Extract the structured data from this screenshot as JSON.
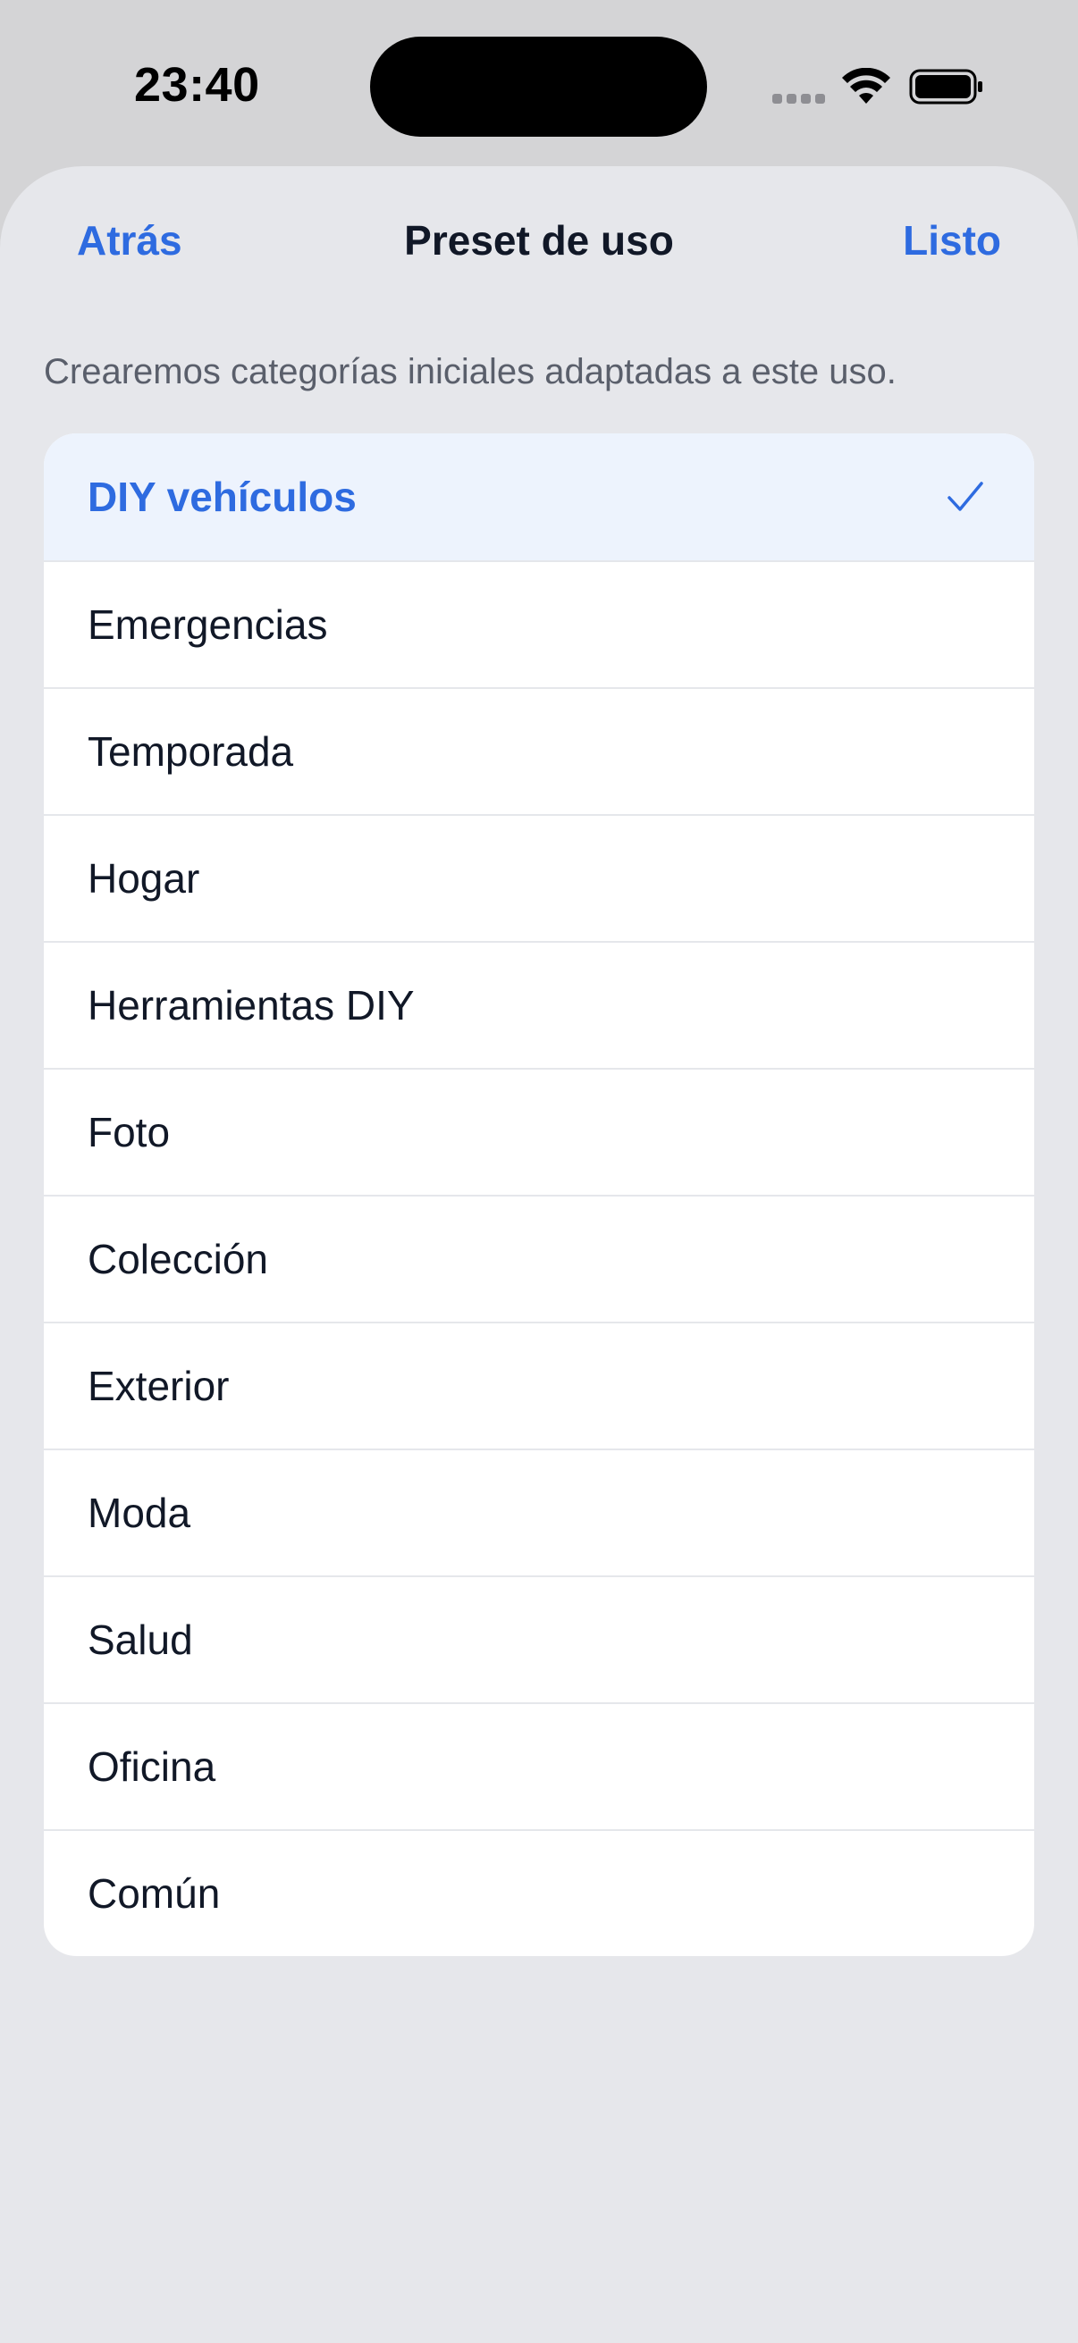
{
  "status_bar": {
    "time": "23:40",
    "icons": [
      "cellular-signal-icon",
      "wifi-icon",
      "battery-icon"
    ]
  },
  "nav": {
    "back_label": "Atrás",
    "title": "Preset de uso",
    "done_label": "Listo"
  },
  "description": "Crearemos categorías iniciales adaptadas a este uso.",
  "presets": [
    {
      "label": "DIY vehículos",
      "selected": true
    },
    {
      "label": "Emergencias",
      "selected": false
    },
    {
      "label": "Temporada",
      "selected": false
    },
    {
      "label": "Hogar",
      "selected": false
    },
    {
      "label": "Herramientas DIY",
      "selected": false
    },
    {
      "label": "Foto",
      "selected": false
    },
    {
      "label": "Colección",
      "selected": false
    },
    {
      "label": "Exterior",
      "selected": false
    },
    {
      "label": "Moda",
      "selected": false
    },
    {
      "label": "Salud",
      "selected": false
    },
    {
      "label": "Oficina",
      "selected": false
    },
    {
      "label": "Común",
      "selected": false
    }
  ],
  "colors": {
    "accent": "#2e6be0",
    "selected_row_bg": "#edf3fd",
    "sheet_bg": "#e6e7eb"
  }
}
